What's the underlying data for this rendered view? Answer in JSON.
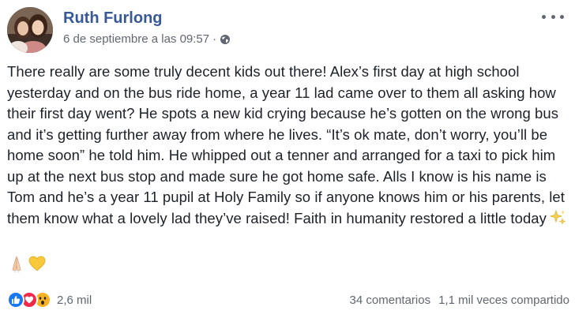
{
  "post": {
    "author_name": "Ruth Furlong",
    "timestamp": "6 de septiembre a las 09:57",
    "separator": "·",
    "privacy_icon": "globe-icon",
    "menu_icon": "more-options-icon",
    "body_text": "There really are some truly decent kids out there! Alex’s first day at high school yesterday and on the bus ride home, a year 11 lad came over to them all asking how their first day went? He spots a new kid crying because he’s gotten on the wrong bus and it’s getting further away from where he lives. “It’s ok mate, don’t worry, you’ll be home soon” he told him. He whipped out a tenner and arranged for a taxi to pick him up at the next bus stop and made sure he got home safe. Alls I know is his name is Tom and he’s a year 11 pupil at Holy Family so if anyone knows him or his parents, let them know what a lovely lad they’ve raised! Faith in humanity restored a little today",
    "trailing_emoji": [
      "sparkles-icon",
      "folded-hands-icon",
      "yellow-heart-icon"
    ]
  },
  "footer": {
    "reaction_icons": [
      "like-icon",
      "love-icon",
      "wow-icon"
    ],
    "reaction_count": "2,6 mil",
    "comments": "34 comentarios",
    "shares": "1,1 mil veces compartido"
  },
  "colors": {
    "author": "#385898",
    "meta": "#616770",
    "text": "#1d2129",
    "like": "#1877f2",
    "love": "#f0284a",
    "wow": "#f7b125"
  }
}
